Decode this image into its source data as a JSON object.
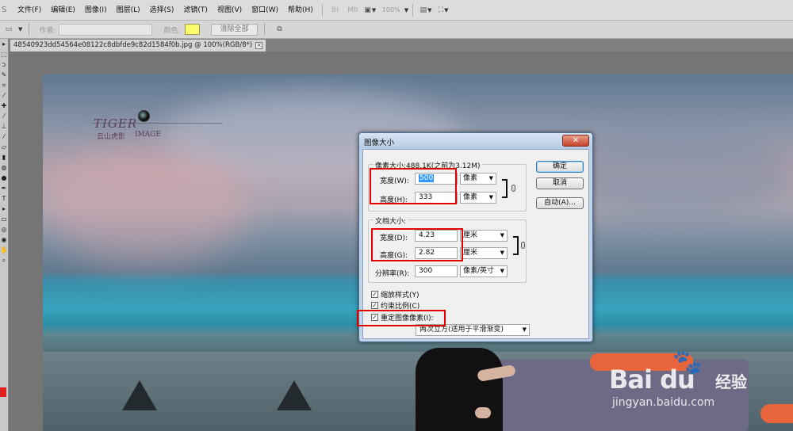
{
  "menubar": {
    "app_glyph": "S",
    "items": [
      "文件(F)",
      "编辑(E)",
      "图像(I)",
      "图层(L)",
      "选择(S)",
      "滤镜(T)",
      "视图(V)",
      "窗口(W)",
      "帮助(H)"
    ],
    "icon_br": "Br",
    "icon_mb": "Mb",
    "zoom": "100%"
  },
  "optbar": {
    "author_label": "作者:",
    "color_label": "颜色:",
    "swatch_color": "#fbfb6e",
    "clear_button": "清除全部"
  },
  "document": {
    "tab_title": "48540923dd54564e08122c8dbfde9c82d1584f0b.jpg @ 100%(RGB/8*)",
    "close_glyph": "×"
  },
  "logo": {
    "word": "TIGER",
    "cn": "云山虎影",
    "image": "IMAGE"
  },
  "watermark": {
    "brand": "Bai  du",
    "cn": "经验",
    "url": "jingyan.baidu.com"
  },
  "dialog": {
    "title": "图像大小",
    "close_glyph": "✕",
    "pixel_dim": {
      "legend": "像素大小:488.1K(之前为3.12M)",
      "width_label": "宽度(W):",
      "width_value": "500",
      "width_unit": "像素",
      "height_label": "高度(H):",
      "height_value": "333",
      "height_unit": "像素"
    },
    "doc_size": {
      "legend": "文档大小:",
      "width_label": "宽度(D):",
      "width_value": "4.23",
      "width_unit": "厘米",
      "height_label": "高度(G):",
      "height_value": "2.82",
      "height_unit": "厘米",
      "resolution_label": "分辨率(R):",
      "resolution_value": "300",
      "resolution_unit": "像素/英寸"
    },
    "checkboxes": {
      "scale_styles": "缩放样式(Y)",
      "constrain": "约束比例(C)",
      "resample": "重定图像像素(I):"
    },
    "resample_method": "两次立方(适用于平滑渐变)",
    "buttons": {
      "ok": "确定",
      "cancel": "取消",
      "auto": "自动(A)..."
    }
  }
}
